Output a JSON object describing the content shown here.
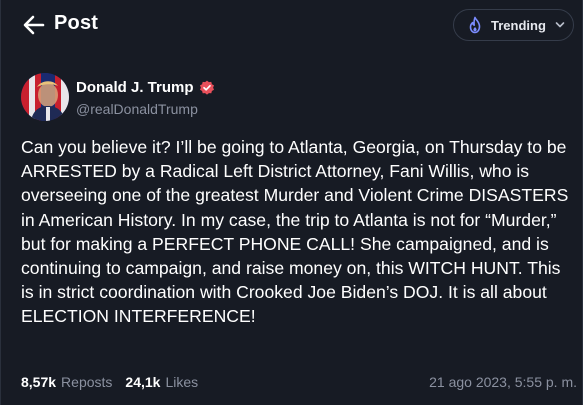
{
  "header": {
    "title": "Post",
    "back_icon": "arrow-left-icon",
    "feed_selector": {
      "label": "Trending",
      "icon": "flame-icon",
      "dropdown_icon": "chevron-down-icon"
    }
  },
  "post": {
    "author": {
      "display_name": "Donald J. Trump",
      "handle": "@realDonaldTrump",
      "verified_icon": "verified-badge-icon"
    },
    "text": "Can you believe it? I’ll be going to Atlanta, Georgia, on Thursday to be ARRESTED by a Radical Left District Attorney, Fani Willis, who is overseeing one of the greatest Murder and Violent Crime DISASTERS in American History. In my case, the trip to Atlanta is not for “Murder,” but for making a PERFECT PHONE CALL! She campaigned, and is continuing to campaign, and raise money on, this WITCH HUNT. This is in strict coordination with Crooked Joe Biden’s DOJ. It is all about ELECTION INTERFERENCE!",
    "stats": {
      "reposts_count": "8,57k",
      "reposts_label": "Reposts",
      "likes_count": "24,1k",
      "likes_label": "Likes"
    },
    "timestamp": "21 ago 2023, 5:55 p. m."
  },
  "colors": {
    "background": "#171b24",
    "text_primary": "#ffffff",
    "text_secondary": "#8b91a0",
    "accent": "#7b8cff",
    "verified": "#e8505b"
  }
}
